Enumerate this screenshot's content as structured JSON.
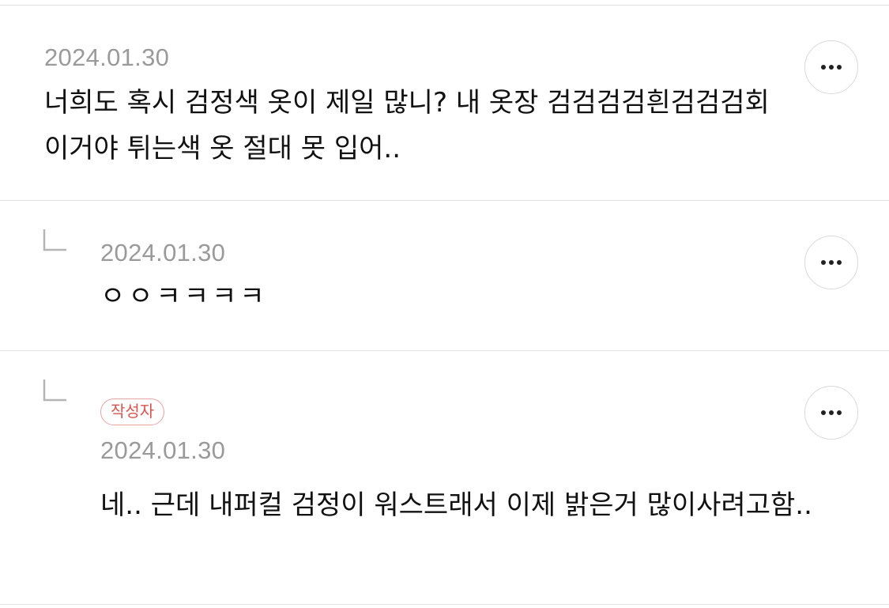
{
  "comments": [
    {
      "date": "2024.01.30",
      "text": "너희도 혹시 검정색 옷이 제일 많니? 내 옷장 검검검검흰검검검회 이거야 튀는색 옷 절대 못 입어..",
      "is_reply": false,
      "author_badge": null
    },
    {
      "date": "2024.01.30",
      "text": "ㅇㅇㅋㅋㅋㅋ",
      "is_reply": true,
      "author_badge": null
    },
    {
      "date": "2024.01.30",
      "text": "네.. 근데 내퍼컬 검정이 워스트래서 이제 밝은거 많이사려고함..",
      "is_reply": true,
      "author_badge": "작성자"
    }
  ],
  "icons": {
    "more": "more-horizontal-icon",
    "reply": "reply-arrow-icon"
  },
  "colors": {
    "author_badge": "#d9534f",
    "date": "#9a9a9a",
    "divider": "#e2e2e2"
  }
}
